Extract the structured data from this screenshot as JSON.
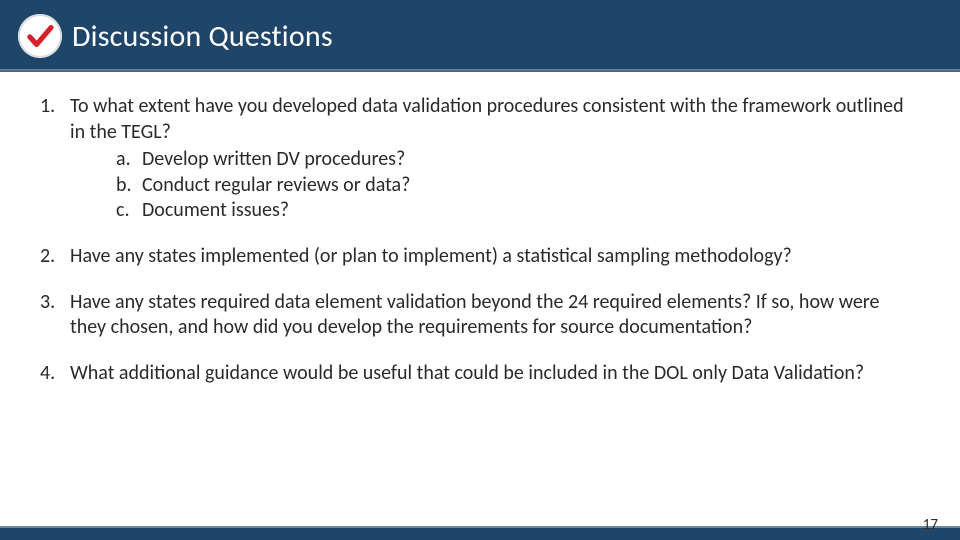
{
  "header": {
    "title": "Discussion Questions",
    "icon": "check-icon"
  },
  "questions": [
    {
      "text": "To what extent have you developed data validation procedures consistent with the framework outlined in the TEGL?",
      "sub": [
        "Develop written DV procedures?",
        "Conduct regular reviews or data?",
        "Document issues?"
      ]
    },
    {
      "text": "Have any states implemented (or plan to implement) a statistical sampling methodology?",
      "sub": []
    },
    {
      "text": "Have any states required data element validation beyond the 24 required elements? If so, how were they chosen, and how did you develop the requirements for source documentation?",
      "sub": []
    },
    {
      "text": "What additional guidance would be useful that could be included in the DOL only Data Validation?",
      "sub": []
    }
  ],
  "page_number": "17",
  "colors": {
    "header_bg": "#1f4569",
    "check_red": "#d61f26"
  }
}
